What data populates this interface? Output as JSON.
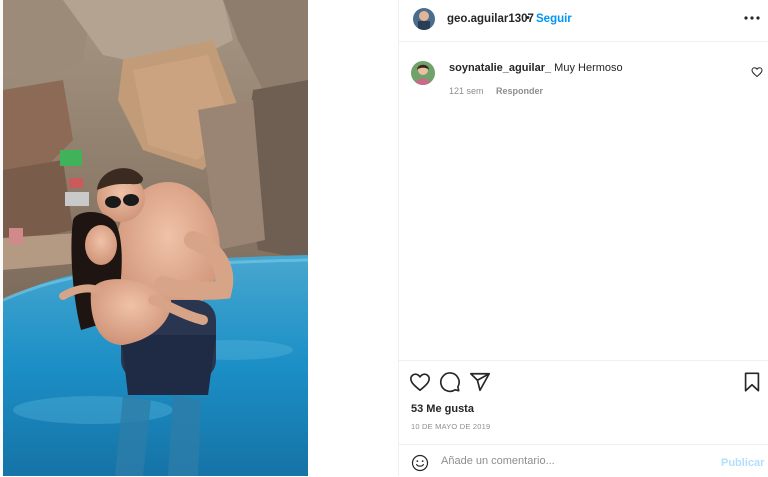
{
  "post": {
    "author": "geo.aguilar1307",
    "separator": "•",
    "follow_label": "Seguir",
    "photo_alt": "Foto de geo.aguilar1307"
  },
  "comments": [
    {
      "username": "soynatalie_aguilar_",
      "text": "Muy Hermoso",
      "time": "121 sem",
      "reply_label": "Responder"
    }
  ],
  "actions": {
    "icons": [
      "heart-icon",
      "comment-icon",
      "share-icon",
      "bookmark-icon"
    ]
  },
  "likes_text": "53 Me gusta",
  "date_text": "10 DE MAYO DE 2019",
  "add_comment": {
    "placeholder": "Añade un comentario...",
    "publish_label": "Publicar"
  },
  "colors": {
    "accent": "#0095f6",
    "publish_disabled": "#b2dffc",
    "muted_text": "#8e8e8e",
    "border": "#efefef"
  }
}
